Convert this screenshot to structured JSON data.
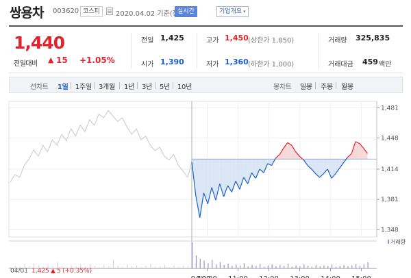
{
  "header": {
    "name": "쌍용차",
    "code": "003620",
    "market": "코스피",
    "basis": "2020.04.02 기준(장마감)",
    "realtime": "실시간",
    "company_info": "기업개요",
    "company_caret": "▾"
  },
  "summary": {
    "price": "1,440",
    "change_label": "전일대비",
    "change_arrow": "▲",
    "change_value": "15",
    "change_pct": "+1.05%",
    "prev_label": "전일",
    "prev_value": "1,425",
    "open_label": "시가",
    "open_value": "1,390",
    "high_label": "고가",
    "high_value": "1,450",
    "high_limit": "(상한가 1,850)",
    "low_label": "저가",
    "low_value": "1,360",
    "low_limit": "(하한가 1,000)",
    "volume_label": "거래량",
    "volume_value": "325,835",
    "amount_label": "거래대금",
    "amount_value": "459",
    "amount_unit": "백만"
  },
  "tabs": {
    "line_label": "선차트",
    "line_tabs": [
      "1일",
      "1주일",
      "3개월",
      "1년",
      "3년",
      "5년",
      "10년"
    ],
    "candle_label": "봉차트",
    "candle_tabs": [
      "일봉",
      "주봉",
      "월봉"
    ]
  },
  "colors": {
    "up": "#e0242c",
    "down": "#1c5fc8",
    "prev_day_line": "#c8c8c8",
    "up_fill": "#f7d2d4",
    "down_fill": "#d5e2f3",
    "volume_bar": "#9a8fc9"
  },
  "chart_data": {
    "type": "line",
    "ylim": [
      1340,
      1488
    ],
    "y_ticks": [
      "1,481",
      "1,448",
      "1,414",
      "1,381",
      "1,348"
    ],
    "y_tick_values": [
      1481,
      1448,
      1414,
      1381,
      1348
    ],
    "x_tick_labels": [
      "04/01",
      "04/02",
      "10:00",
      "11:00",
      "12:00",
      "13:00",
      "14:00",
      "15:00"
    ],
    "x_tick_times": [
      null,
      0,
      30,
      90,
      150,
      210,
      270,
      330
    ],
    "baseline": 1425,
    "volume_legend": "거래량",
    "prev_summary": {
      "date": "04/01",
      "price": "1,425",
      "arrow": "▲",
      "change": "5",
      "pct": "(+0.35%)"
    },
    "series": [
      {
        "day": "04/01",
        "values": [
          1400,
          1408,
          1405,
          1418,
          1425,
          1435,
          1428,
          1440,
          1433,
          1446,
          1440,
          1452,
          1445,
          1458,
          1450,
          1462,
          1455,
          1468,
          1462,
          1474,
          1470,
          1478,
          1472,
          1466,
          1470,
          1460,
          1452,
          1458,
          1446,
          1450,
          1440,
          1434,
          1438,
          1428,
          1424,
          1430,
          1418,
          1412,
          1405
        ]
      },
      {
        "day": "04/02",
        "values": [
          1422,
          1385,
          1361,
          1388,
          1376,
          1394,
          1380,
          1398,
          1384,
          1396,
          1389,
          1401,
          1392,
          1405,
          1398,
          1410,
          1404,
          1414,
          1410,
          1420,
          1418,
          1426,
          1430,
          1437,
          1443,
          1440,
          1433,
          1428,
          1424,
          1418,
          1414,
          1409,
          1405,
          1409,
          1414,
          1404,
          1409,
          1415,
          1421,
          1427,
          1431,
          1444,
          1442,
          1437,
          1431
        ]
      }
    ],
    "volume": {
      "day_0401": [
        3,
        6,
        4,
        9,
        5,
        12,
        7,
        4,
        8,
        5,
        14,
        6,
        3,
        7,
        5,
        9,
        4,
        10,
        6,
        3,
        8,
        5,
        20,
        6,
        4,
        9,
        5,
        7,
        3,
        6,
        11,
        4,
        5,
        8,
        3,
        7,
        4,
        6,
        5
      ],
      "day_0402": [
        60,
        30,
        22,
        18,
        12,
        20,
        9,
        14,
        8,
        11,
        6,
        9,
        7,
        12,
        5,
        8,
        6,
        10,
        4,
        7,
        9,
        5,
        8,
        6,
        11,
        4,
        7,
        5,
        9,
        6,
        4,
        8,
        5,
        7,
        6,
        9,
        4,
        6,
        8,
        5,
        7,
        10,
        6,
        9,
        14
      ]
    }
  }
}
